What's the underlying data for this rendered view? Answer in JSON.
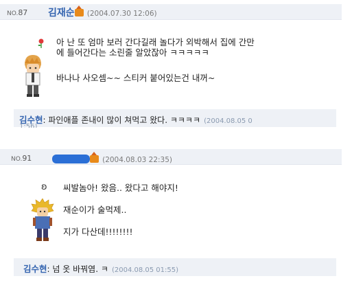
{
  "posts": [
    {
      "no_prefix": "NO.",
      "no": "87",
      "author": "김재순",
      "date": "(2004.07.30 12:06)",
      "lines": [
        "아 난 또 엄마 보러 간다길래 놀다가 외박해서 집에 간만",
        "에 들어간다는 소린줄 알았잖아 ㅋㅋㅋㅋㅋ",
        "바나나 사오셈~~ 스티커 붙어있는건 내꺼~"
      ],
      "comment": {
        "name": "김수현",
        "text": "파인애플 존내이 많이 쳐먹고 왔다. ㅋㅋㅋㅋ",
        "date": "(2004.08.05 0",
        "date_cont": "1:56)"
      }
    },
    {
      "no_prefix": "NO.",
      "no": "91",
      "author": "",
      "date": "(2004.08.03 22:35)",
      "lines": [
        "씨발놈아! 왔음.. 왔다고 해야지!",
        "재순이가 술먹제..",
        "지가 다산데!!!!!!!!"
      ],
      "comment": {
        "name": "김수현",
        "text": "넘 옷 바꿔염. ㅋ",
        "date": "(2004.08.05 01:55)"
      }
    }
  ],
  "colors": {
    "header_bg": "#eef1f6",
    "author": "#3565b0",
    "comment_bg": "#eef1f6"
  },
  "icons": [
    "home-icon",
    "flower-icon",
    "question-icon",
    "avatar"
  ]
}
